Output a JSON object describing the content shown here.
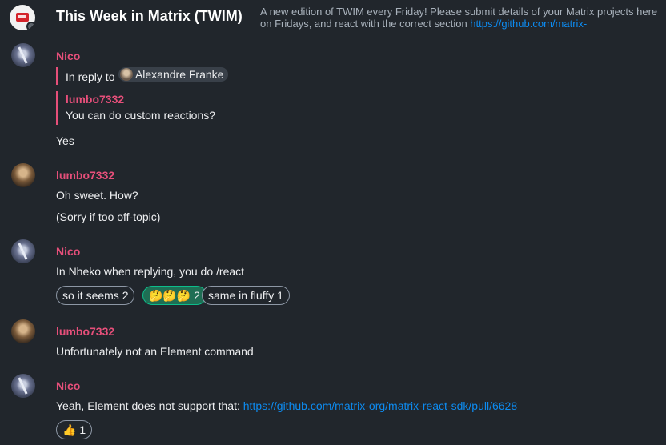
{
  "header": {
    "room_name": "This Week in Matrix (TWIM)",
    "topic_text": "A new edition of TWIM every Friday! Please submit details of your Matrix projects here on Fridays, and react with the correct section ",
    "topic_link": "https://github.com/matrix-"
  },
  "messages": {
    "m1": {
      "sender": "Nico",
      "reply_prefix": "In reply to",
      "reply_user": "Alexandre Franke",
      "quoted_sender": "lumbo7332",
      "quoted_text": "You can do custom reactions?",
      "body": "Yes"
    },
    "m2": {
      "sender": "lumbo7332",
      "line1": "Oh sweet. How?",
      "line2": "(Sorry if too off-topic)"
    },
    "m3": {
      "sender": "Nico",
      "body": "In Nheko when replying, you do /react",
      "reactions": [
        "so it seems 2",
        "🤔🤔🤔 2",
        "same in fluffy 1"
      ]
    },
    "m4": {
      "sender": "lumbo7332",
      "body": "Unfortunately not an Element command"
    },
    "m5": {
      "sender": "Nico",
      "body_prefix": "Yeah, Element does not support that: ",
      "link": "https://github.com/matrix-org/matrix-react-sdk/pull/6628",
      "reaction": "👍 1"
    }
  },
  "colors": {
    "background": "#21262c",
    "accent_link": "#0d8bf0",
    "sender_color": "#e64f7a",
    "reaction_active": "#1f6e54"
  }
}
